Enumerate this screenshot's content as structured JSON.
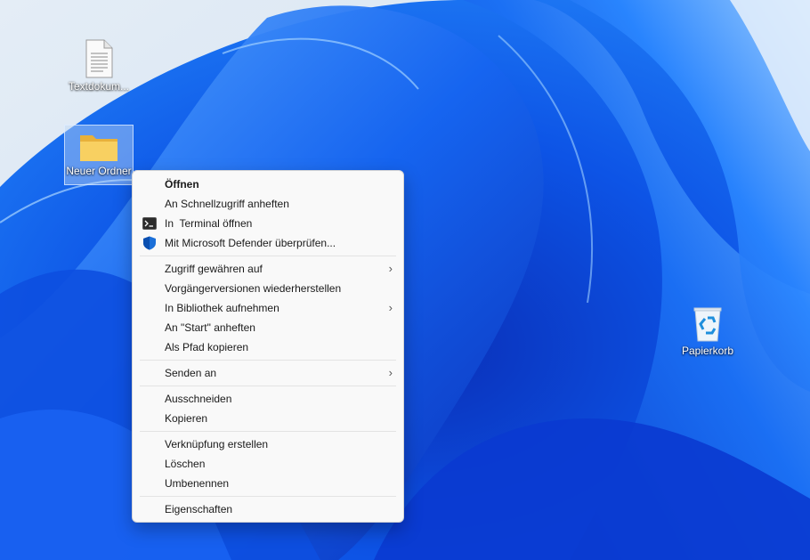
{
  "desktop": {
    "icons": [
      {
        "name": "Textdokum...",
        "icon": "text-document-icon"
      },
      {
        "name": "Neuer Ordner",
        "icon": "folder-icon",
        "selected": true
      },
      {
        "name": "Papierkorb",
        "icon": "recycle-bin-icon"
      }
    ]
  },
  "context_menu": {
    "groups": [
      [
        {
          "label": "Öffnen",
          "bold": true
        },
        {
          "label": "An Schnellzugriff anheften"
        },
        {
          "label": "In  Terminal öffnen",
          "icon": "terminal-icon"
        },
        {
          "label": "Mit Microsoft Defender überprüfen...",
          "icon": "defender-shield-icon"
        }
      ],
      [
        {
          "label": "Zugriff gewähren auf",
          "submenu": true
        },
        {
          "label": "Vorgängerversionen wiederherstellen"
        },
        {
          "label": "In Bibliothek aufnehmen",
          "submenu": true
        },
        {
          "label": "An \"Start\" anheften"
        },
        {
          "label": "Als Pfad kopieren"
        }
      ],
      [
        {
          "label": "Senden an",
          "submenu": true
        }
      ],
      [
        {
          "label": "Ausschneiden"
        },
        {
          "label": "Kopieren"
        }
      ],
      [
        {
          "label": "Verknüpfung erstellen"
        },
        {
          "label": "Löschen"
        },
        {
          "label": "Umbenennen"
        }
      ],
      [
        {
          "label": "Eigenschaften"
        }
      ]
    ],
    "submenu_glyph": "›"
  },
  "colors": {
    "accent": "#0067c0",
    "wallpaper_dark": "#0a3fd6",
    "wallpaper_light": "#d9e6f3",
    "folder": "#f6c94a"
  }
}
